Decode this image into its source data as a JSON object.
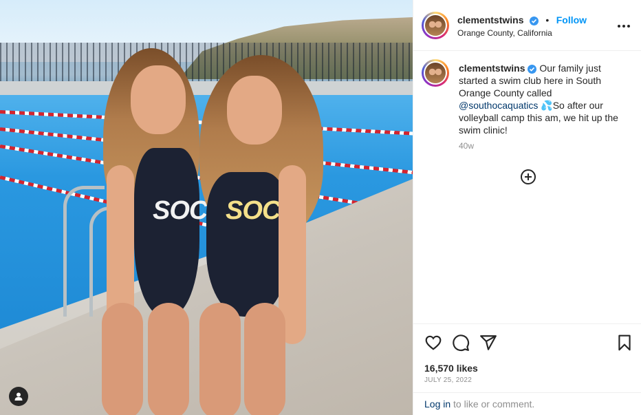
{
  "post": {
    "photo_text": "SOC",
    "tag_icon": "user-icon"
  },
  "header": {
    "username": "clementstwins",
    "separator": "•",
    "follow_label": "Follow",
    "location": "Orange County, California",
    "more_icon": "ellipsis-icon"
  },
  "caption": {
    "username": "clementstwins",
    "text_before": "Our family just started a swim club here in South Orange County called",
    "mention": "@southocaquatics",
    "emoji": "💦",
    "text_after": "So after our volleyball camp this am, we hit up the swim clinic!",
    "time_ago": "40w"
  },
  "actions": {
    "icons": [
      "heart-icon",
      "comment-icon",
      "share-icon",
      "bookmark-icon"
    ],
    "likes": "16,570 likes",
    "date": "JULY 25, 2022"
  },
  "footer": {
    "login_link": "Log in",
    "login_text": "to like or comment."
  },
  "colors": {
    "accent": "#0095f6",
    "verified": "#3897f0",
    "text": "#262626",
    "muted": "#8e8e8e",
    "link": "#00376b"
  }
}
